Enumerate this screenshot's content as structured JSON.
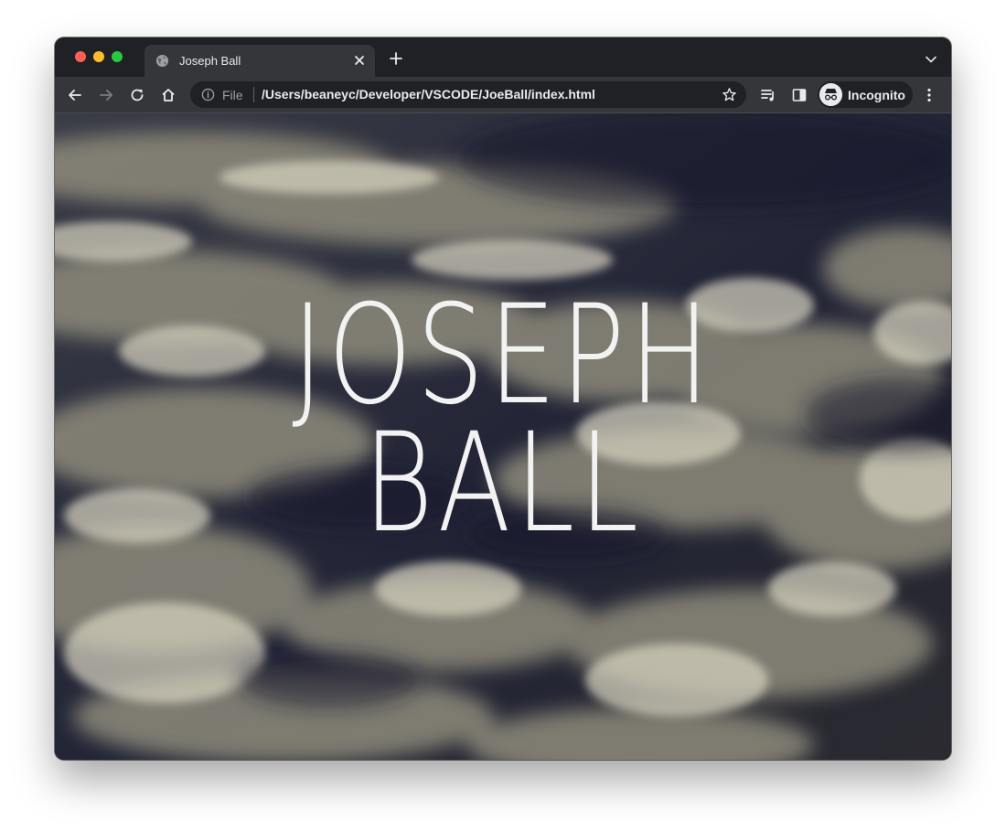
{
  "browser": {
    "tab": {
      "title": "Joseph Ball",
      "icon": "globe-icon"
    },
    "omnibox": {
      "scheme": "File",
      "url": "/Users/beaneyc/Developer/VSCODE/JoeBall/index.html"
    },
    "profile": {
      "label": "Incognito",
      "icon": "incognito-icon"
    },
    "colors": {
      "frame": "#202124",
      "toolbar": "#35363a",
      "text": "#e8eaed"
    }
  },
  "page": {
    "hero": {
      "line1": "Joseph",
      "line2": "Ball"
    },
    "background": "cloud-sky-photo"
  }
}
